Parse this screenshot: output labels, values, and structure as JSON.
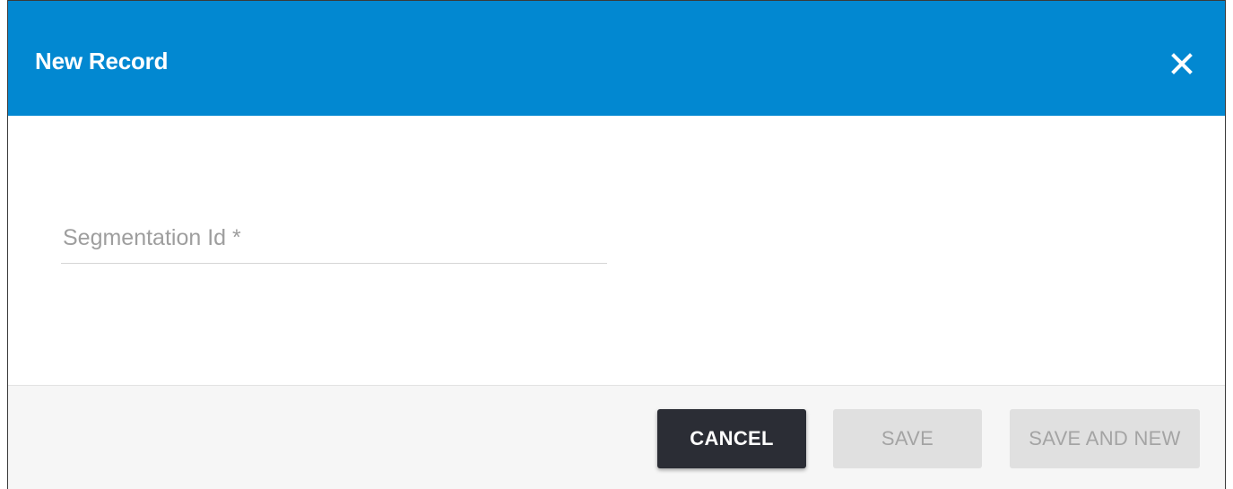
{
  "dialog": {
    "title": "New Record",
    "close_icon": "close-icon",
    "accent_color": "#0288d1"
  },
  "form": {
    "segmentation_id": {
      "placeholder": "Segmentation Id *",
      "value": ""
    }
  },
  "footer": {
    "cancel_label": "CANCEL",
    "save_label": "SAVE",
    "save_and_new_label": "SAVE AND NEW"
  }
}
